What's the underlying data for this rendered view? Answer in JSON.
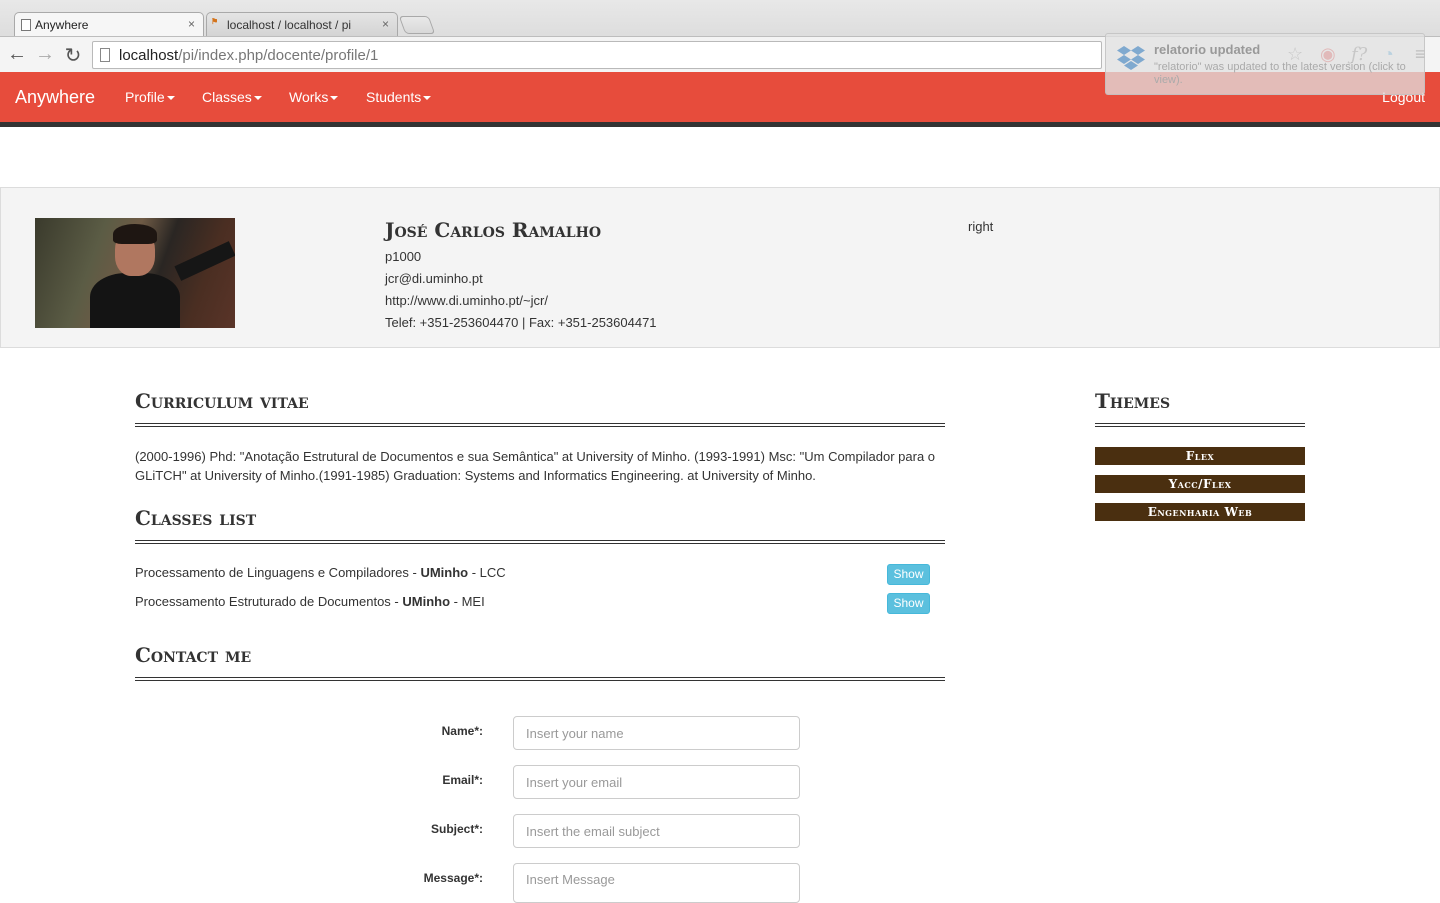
{
  "browser": {
    "tabs": [
      {
        "label": "Anywhere",
        "close": "×"
      },
      {
        "label": "localhost / localhost / pi",
        "close": "×"
      }
    ],
    "url_host": "localhost",
    "url_path": "/pi/index.php/docente/profile/1",
    "notification": {
      "title": "relatorio updated",
      "message": "\"relatorio\" was updated to the latest version (click to view)."
    }
  },
  "navbar": {
    "brand": "Anywhere",
    "items": [
      "Profile",
      "Classes",
      "Works",
      "Students"
    ],
    "logout": "Logout",
    "color": "#e74c3c"
  },
  "profile": {
    "name": "José Carlos Ramalho",
    "code": "p1000",
    "email": "jcr@di.uminho.pt",
    "website": "http://www.di.uminho.pt/~jcr/",
    "phone": "Telef: +351-253604470 | Fax: +351-253604471",
    "right": "right"
  },
  "cv": {
    "title": "Curriculum vitae",
    "text": "(2000-1996) Phd: \"Anotação Estrutural de Documentos e sua Semântica\" at University of Minho. (1993-1991) Msc: \"Um Compilador para o GLiTCH\" at University of Minho.(1991-1985) Graduation: Systems and Informatics Engineering. at University of Minho."
  },
  "classes": {
    "title": "Classes list",
    "items": [
      {
        "name": "Processamento de Linguagens e Compiladores",
        "uni": "UMinho",
        "course": "LCC",
        "button": "Show"
      },
      {
        "name": "Processamento Estruturado de Documentos",
        "uni": "UMinho",
        "course": "MEI",
        "button": "Show"
      }
    ]
  },
  "contact": {
    "title": "Contact me",
    "fields": [
      {
        "label": "Name*:",
        "placeholder": "Insert your name"
      },
      {
        "label": "Email*:",
        "placeholder": "Insert your email"
      },
      {
        "label": "Subject*:",
        "placeholder": "Insert the email subject"
      },
      {
        "label": "Message*:",
        "placeholder": "Insert Message"
      }
    ]
  },
  "themes": {
    "title": "Themes",
    "items": [
      "Flex",
      "Yacc/Flex",
      "Engenharia Web"
    ],
    "badge_color": "#4a2f10"
  },
  "icons": [
    "back-arrow-icon",
    "forward-arrow-icon",
    "reload-icon",
    "page-icon",
    "star-icon",
    "dropbox-icon",
    "menu-icon"
  ]
}
